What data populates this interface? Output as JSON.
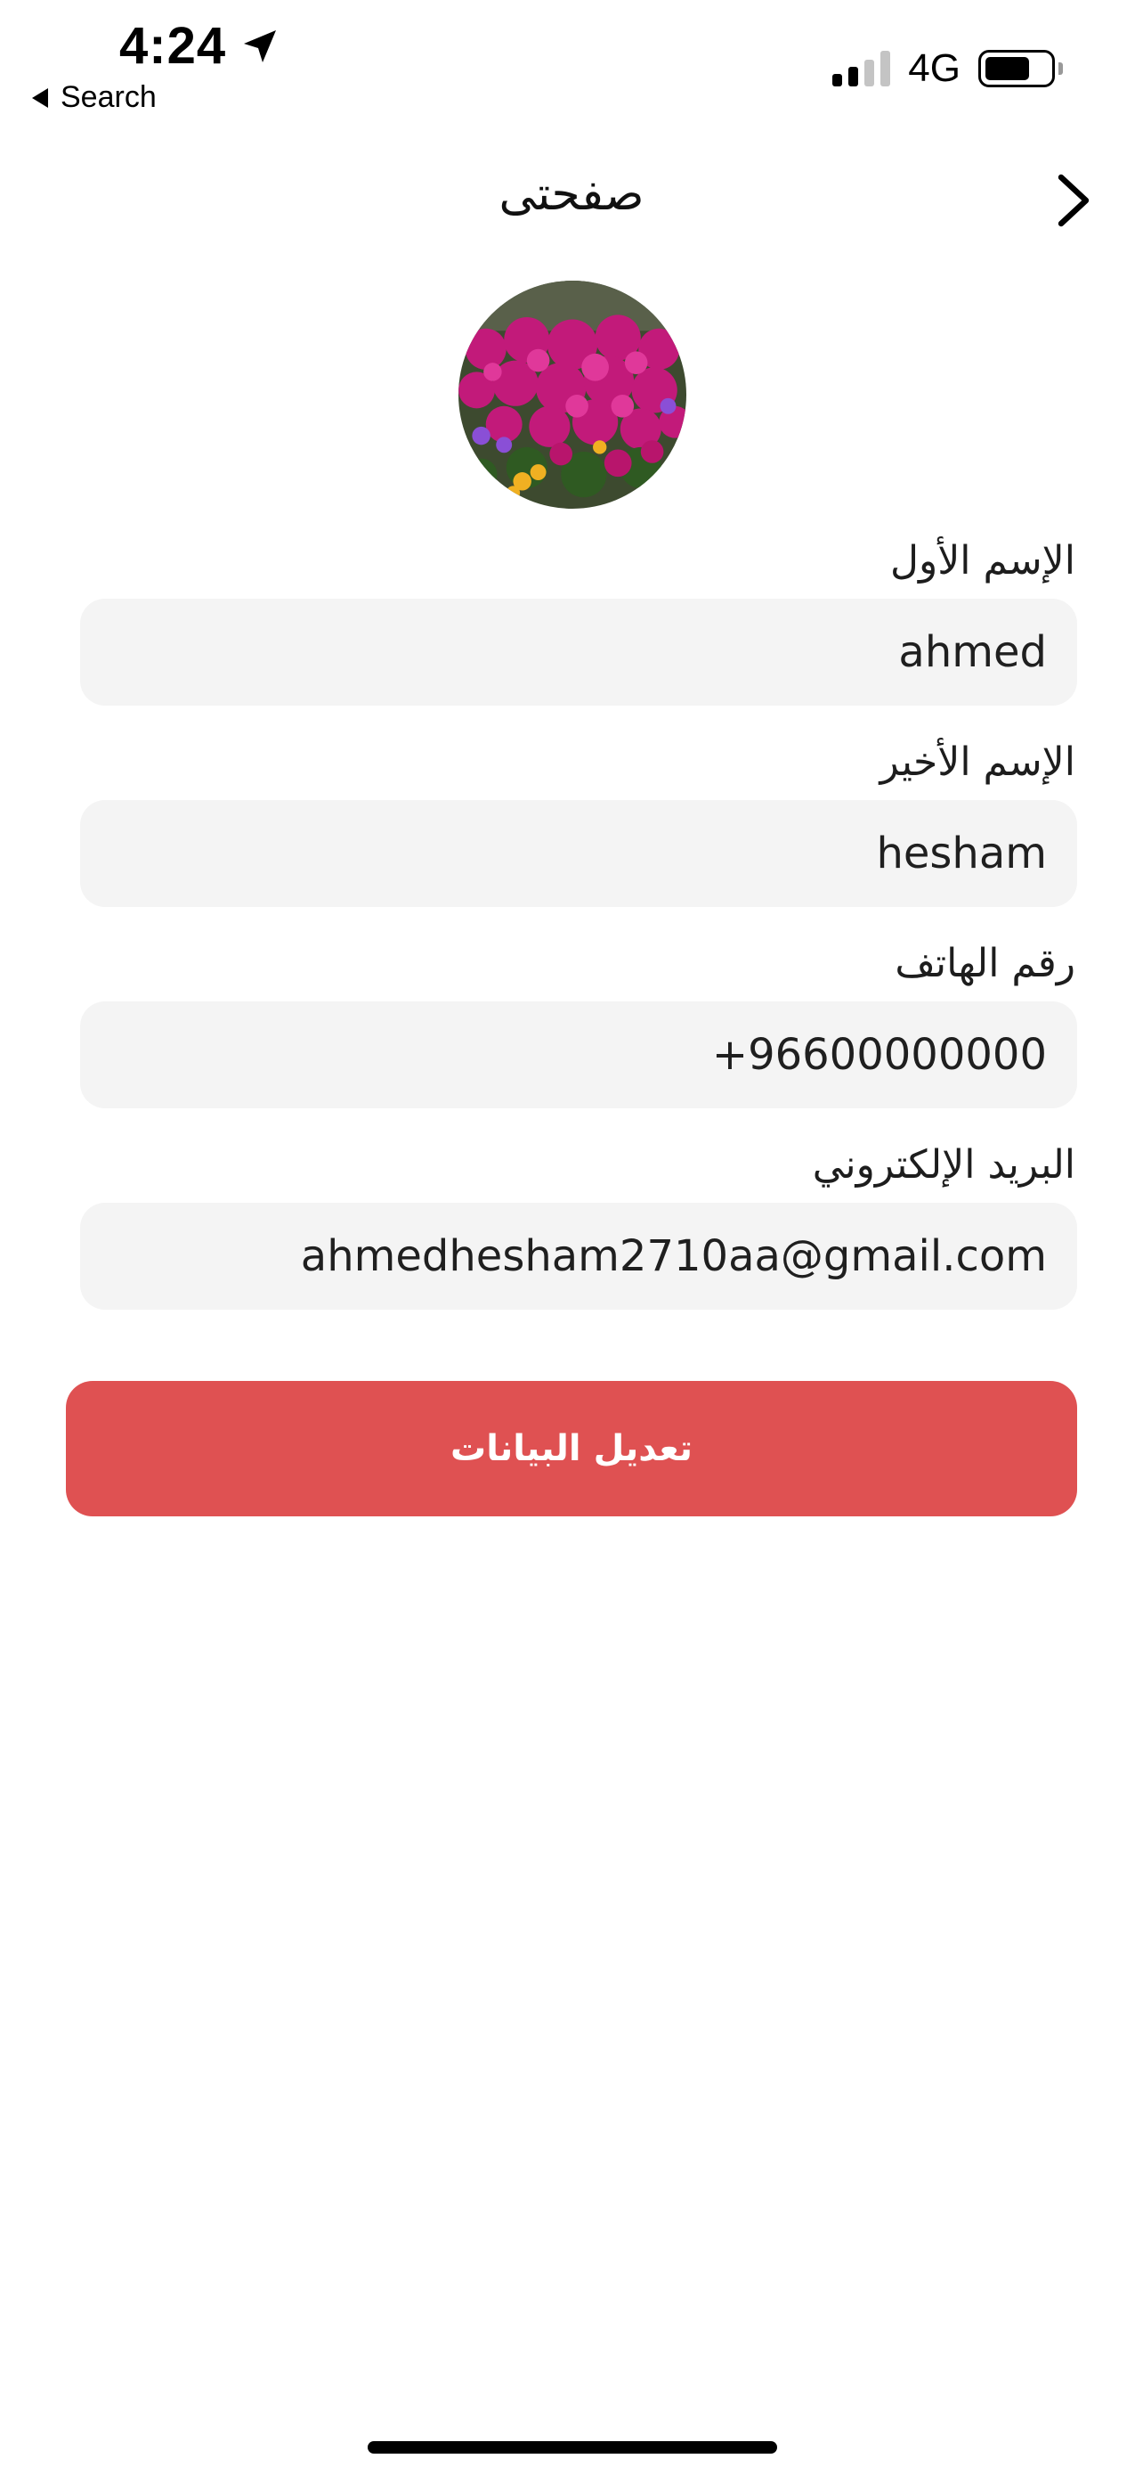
{
  "status_bar": {
    "time": "4:24",
    "back_app_label": "Search",
    "network": "4G",
    "battery_level": 0.7,
    "signal_bars_active": 2
  },
  "header": {
    "title": "صفحتى"
  },
  "form": {
    "first_name": {
      "label": "الإسم الأول",
      "value": "ahmed"
    },
    "last_name": {
      "label": "الإسم الأخير",
      "value": "hesham"
    },
    "phone": {
      "label": "رقم الهاتف",
      "value": "+96600000000"
    },
    "email": {
      "label": "البريد الإلكتروني",
      "value": "ahmedhesham2710aa@gmail.com"
    }
  },
  "actions": {
    "edit_label": "تعديل البيانات"
  },
  "colors": {
    "accent": "#df5152",
    "input_bg": "#f4f4f4"
  }
}
